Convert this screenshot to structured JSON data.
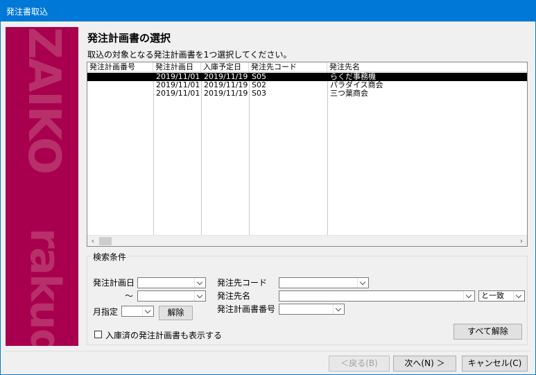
{
  "window": {
    "title": "発注書取込"
  },
  "banner": {
    "watermark_top": "ZAIKO",
    "watermark_bottom": "rakuda"
  },
  "page": {
    "heading": "発注計画書の選択",
    "instruction": "取込の対象となる発注計画書を1つ選択してください。"
  },
  "list": {
    "columns": [
      "発注計画番号",
      "発注計画日",
      "入庫予定日",
      "発注先コード",
      "発注先名"
    ],
    "rows": [
      {
        "cells": [
          "",
          "2019/11/01",
          "2019/11/19",
          "S05",
          "らくだ事務機"
        ],
        "selected": true
      },
      {
        "cells": [
          "",
          "2019/11/01",
          "2019/11/19",
          "S02",
          "パラダイス商会"
        ],
        "selected": false
      },
      {
        "cells": [
          "",
          "2019/11/01",
          "2019/11/19",
          "S03",
          "三つ葉商会"
        ],
        "selected": false
      }
    ],
    "scroll_left_icon": "‹",
    "scroll_right_icon": "›"
  },
  "search": {
    "title": "検索条件",
    "plan_date_label": "発注計画日",
    "tilde": "～",
    "plan_date_from": "",
    "plan_date_to": "",
    "month_label": "月指定",
    "month_value": "",
    "clear_label": "解除",
    "supplier_code_label": "発注先コード",
    "supplier_code_value": "",
    "supplier_name_label": "発注先名",
    "supplier_name_value": "",
    "match_value": "と一致",
    "plan_number_label": "発注計画書番号",
    "plan_number_value": "",
    "show_received_label": "入庫済の発注計画書も表示する",
    "show_received_checked": false,
    "clear_all_label": "すべて解除"
  },
  "footer": {
    "back_label": "＜戻る(B)",
    "next_label": "次へ(N) ＞",
    "cancel_label": "キャンセル(C)"
  }
}
